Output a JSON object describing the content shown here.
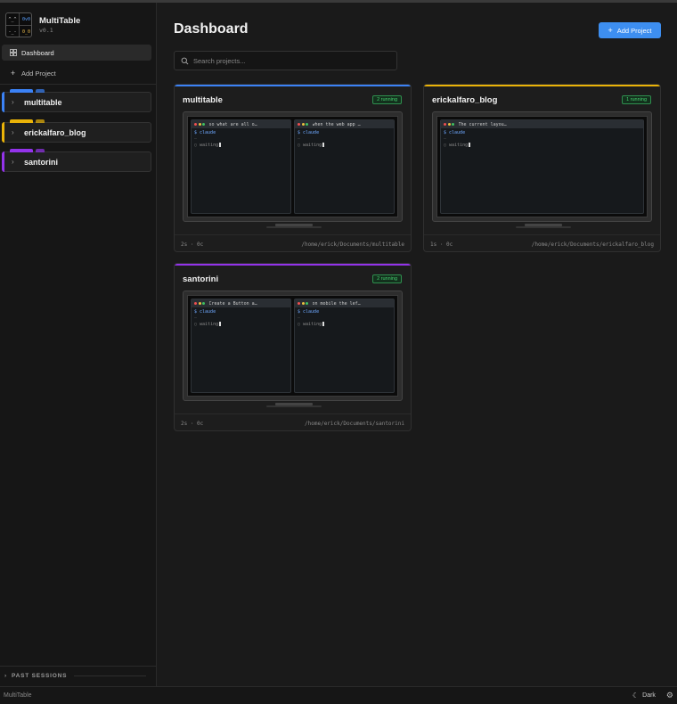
{
  "app": {
    "name": "MultiTable",
    "version": "v0.1"
  },
  "logo": {
    "q1": "^_^",
    "q2": "0v0",
    "q3": "-_-",
    "q4": "0_0"
  },
  "nav": {
    "dashboard": "Dashboard",
    "add_project": "Add Project"
  },
  "sidebar_projects": [
    {
      "name": "multitable",
      "color": "#3b82f6"
    },
    {
      "name": "erickalfaro_blog",
      "color": "#eab308"
    },
    {
      "name": "santorini",
      "color": "#9333ea"
    }
  ],
  "past_sessions": "PAST SESSIONS",
  "main": {
    "title": "Dashboard",
    "add_button": "Add Project",
    "search_placeholder": "Search projects..."
  },
  "cards": [
    {
      "name": "multitable",
      "color": "#3b82f6",
      "badge": "2 running",
      "terms": [
        {
          "title": "so what are all o…",
          "cmd": "$ claude",
          "dim": "—",
          "status": "waiting"
        },
        {
          "title": "when the web app …",
          "cmd": "$ claude",
          "dim": "—",
          "status": "waiting"
        }
      ],
      "stats": "2s · 0c",
      "path": "/home/erick/Documents/multitable"
    },
    {
      "name": "erickalfaro_blog",
      "color": "#eab308",
      "badge": "1 running",
      "terms": [
        {
          "title": "The current layou…",
          "cmd": "$ claude",
          "dim": "—",
          "status": "waiting"
        }
      ],
      "stats": "1s · 0c",
      "path": "/home/erick/Documents/erickalfaro_blog"
    },
    {
      "name": "santorini",
      "color": "#9333ea",
      "badge": "2 running",
      "terms": [
        {
          "title": "Create a Button a…",
          "cmd": "$ claude",
          "dim": "—",
          "status": "waiting"
        },
        {
          "title": "on mobile the lef…",
          "cmd": "$ claude",
          "dim": "—",
          "status": "waiting"
        }
      ],
      "stats": "2s · 0c",
      "path": "/home/erick/Documents/santorini"
    }
  ],
  "statusbar": {
    "left": "MultiTable",
    "theme": "Dark"
  }
}
